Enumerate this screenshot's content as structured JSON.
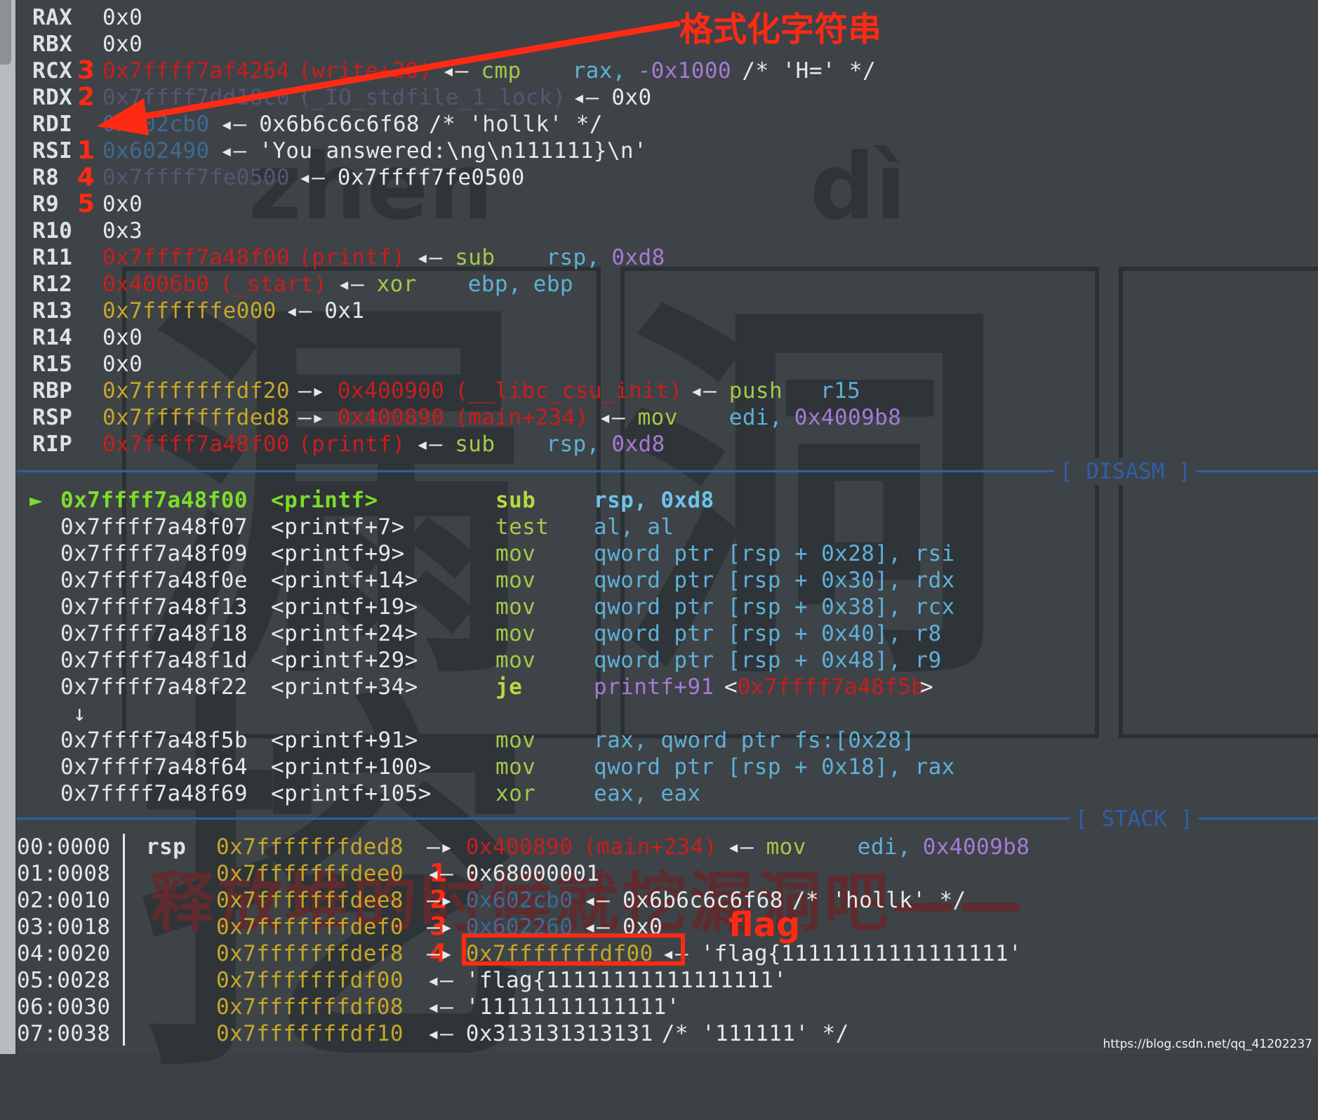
{
  "registers": [
    {
      "name": "RAX",
      "num": "",
      "value": "0x0"
    },
    {
      "name": "RBX",
      "num": "",
      "value": "0x0"
    },
    {
      "name": "RCX",
      "num": "3",
      "addr": "0x7ffff7af4264",
      "sym": "(write+20)",
      "insn": "cmp",
      "op1": "rax,",
      "op2": "-0x1000",
      "comment": "/* 'H=' */"
    },
    {
      "name": "RDX",
      "num": "2",
      "addr": "0x7ffff7dd18c0",
      "sym": "(_IO_stdfile_1_lock)",
      "deref": "0x0"
    },
    {
      "name": "RDI",
      "num": "",
      "addr": "0x602cb0",
      "deref": "0x6b6c6c6f68",
      "comment": "/* 'hollk' */"
    },
    {
      "name": "RSI",
      "num": "1",
      "addr": "0x602490",
      "deref": "'You answered:\\ng\\n111111}\\n'"
    },
    {
      "name": "R8",
      "num": "4",
      "addr": "0x7ffff7fe0500",
      "deref": "0x7ffff7fe0500"
    },
    {
      "name": "R9",
      "num": "5",
      "value": "0x0"
    },
    {
      "name": "R10",
      "num": "",
      "value": "0x3"
    },
    {
      "name": "R11",
      "num": "",
      "addr": "0x7ffff7a48f00",
      "sym": "(printf)",
      "insn": "sub",
      "op1": "rsp,",
      "op2": "0xd8"
    },
    {
      "name": "R12",
      "num": "",
      "addr": "0x4006b0",
      "sym": "(_start)",
      "insn": "xor",
      "op1": "ebp,",
      "op2": "ebp"
    },
    {
      "name": "R13",
      "num": "",
      "addr": "0x7ffffffe000",
      "deref": "0x1"
    },
    {
      "name": "R14",
      "num": "",
      "value": "0x0"
    },
    {
      "name": "R15",
      "num": "",
      "value": "0x0"
    },
    {
      "name": "RBP",
      "num": "",
      "addr": "0x7fffffffdf20",
      "target": "0x400900",
      "sym": "(__libc_csu_init)",
      "insn": "push",
      "op1": "r15"
    },
    {
      "name": "RSP",
      "num": "",
      "addr": "0x7fffffffded8",
      "target": "0x400890",
      "sym": "(main+234)",
      "insn": "mov",
      "op1": "edi,",
      "op2": "0x4009b8"
    },
    {
      "name": "RIP",
      "num": "",
      "addr": "0x7ffff7a48f00",
      "sym": "(printf)",
      "insn": "sub",
      "op1": "rsp,",
      "op2": "0xd8"
    }
  ],
  "sections": {
    "disasm": "[ DISASM ]",
    "stack": "[ STACK ]"
  },
  "disasm": [
    {
      "marker": "►",
      "addr": "0x7ffff7a48f00",
      "sym": "<printf>",
      "insn": "sub",
      "ops": "rsp, 0xd8"
    },
    {
      "addr": "0x7ffff7a48f07",
      "sym": "<printf+7>",
      "insn": "test",
      "ops": "al, al"
    },
    {
      "addr": "0x7ffff7a48f09",
      "sym": "<printf+9>",
      "insn": "mov",
      "ops": "qword ptr [rsp + 0x28], rsi"
    },
    {
      "addr": "0x7ffff7a48f0e",
      "sym": "<printf+14>",
      "insn": "mov",
      "ops": "qword ptr [rsp + 0x30], rdx"
    },
    {
      "addr": "0x7ffff7a48f13",
      "sym": "<printf+19>",
      "insn": "mov",
      "ops": "qword ptr [rsp + 0x38], rcx"
    },
    {
      "addr": "0x7ffff7a48f18",
      "sym": "<printf+24>",
      "insn": "mov",
      "ops": "qword ptr [rsp + 0x40], r8"
    },
    {
      "addr": "0x7ffff7a48f1d",
      "sym": "<printf+29>",
      "insn": "mov",
      "ops": "qword ptr [rsp + 0x48], r9"
    },
    {
      "addr": "0x7ffff7a48f22",
      "sym": "<printf+34>",
      "insn": "je",
      "ops": "printf+91",
      "target": "0x7ffff7a48f5b"
    },
    {
      "jump": "↓"
    },
    {
      "addr": "0x7ffff7a48f5b",
      "sym": "<printf+91>",
      "insn": "mov",
      "ops": "rax, qword ptr fs:[0x28]"
    },
    {
      "addr": "0x7ffff7a48f64",
      "sym": "<printf+100>",
      "insn": "mov",
      "ops": "qword ptr [rsp + 0x18], rax"
    },
    {
      "addr": "0x7ffff7a48f69",
      "sym": "<printf+105>",
      "insn": "xor",
      "ops": "eax, eax"
    }
  ],
  "stack": [
    {
      "idx": "00:0000",
      "reg": "rsp",
      "addr": "0x7fffffffded8",
      "arrow": "—▸",
      "target": "0x400890",
      "sym": "(main+234)",
      "insn": "mov",
      "op1": "edi,",
      "op2": "0x4009b8"
    },
    {
      "idx": "01:0008",
      "reg": "",
      "num": "1",
      "addr": "0x7fffffffdee0",
      "arrow": "◂—",
      "val": "0x68000001"
    },
    {
      "idx": "02:0010",
      "reg": "",
      "num": "2",
      "addr": "0x7fffffffdee8",
      "arrow": "—▸",
      "target": "0x602cb0",
      "deref": "0x6b6c6c6f68",
      "comment": "/* 'hollk' */"
    },
    {
      "idx": "03:0018",
      "reg": "",
      "num": "3",
      "addr": "0x7fffffffdef0",
      "arrow": "—▸",
      "target": "0x602260",
      "deref": "0x0"
    },
    {
      "idx": "04:0020",
      "reg": "",
      "num": "4",
      "addr": "0x7fffffffdef8",
      "arrow": "—▸",
      "target": "0x7fffffffdf00",
      "deref": "'flag{11111111111111111'"
    },
    {
      "idx": "05:0028",
      "reg": "",
      "addr": "0x7fffffffdf00",
      "arrow": "◂—",
      "val": "'flag{11111111111111111'"
    },
    {
      "idx": "06:0030",
      "reg": "",
      "addr": "0x7fffffffdf08",
      "arrow": "◂—",
      "val": "'11111111111111'"
    },
    {
      "idx": "07:0038",
      "reg": "",
      "addr": "0x7fffffffdf10",
      "arrow": "◂—",
      "val": "0x313131313131",
      "comment": "/* '111111' */"
    }
  ],
  "annotations": {
    "format_string": "格式化字符串",
    "flag": "flag"
  },
  "watermark": {
    "pinyin1": "zhen",
    "pinyin2": "dì",
    "chars": "漏洞挖",
    "banner": "释放堆的时候就挖漏洞吧——"
  },
  "footer_url": "https://blog.csdn.net/qq_41202237",
  "colors": {
    "background": "#3e4347",
    "section_rule": "#2f5fa8",
    "annotation": "#ff2a14",
    "address_red": "#c81e1e",
    "address_yellow": "#c6a72a"
  }
}
